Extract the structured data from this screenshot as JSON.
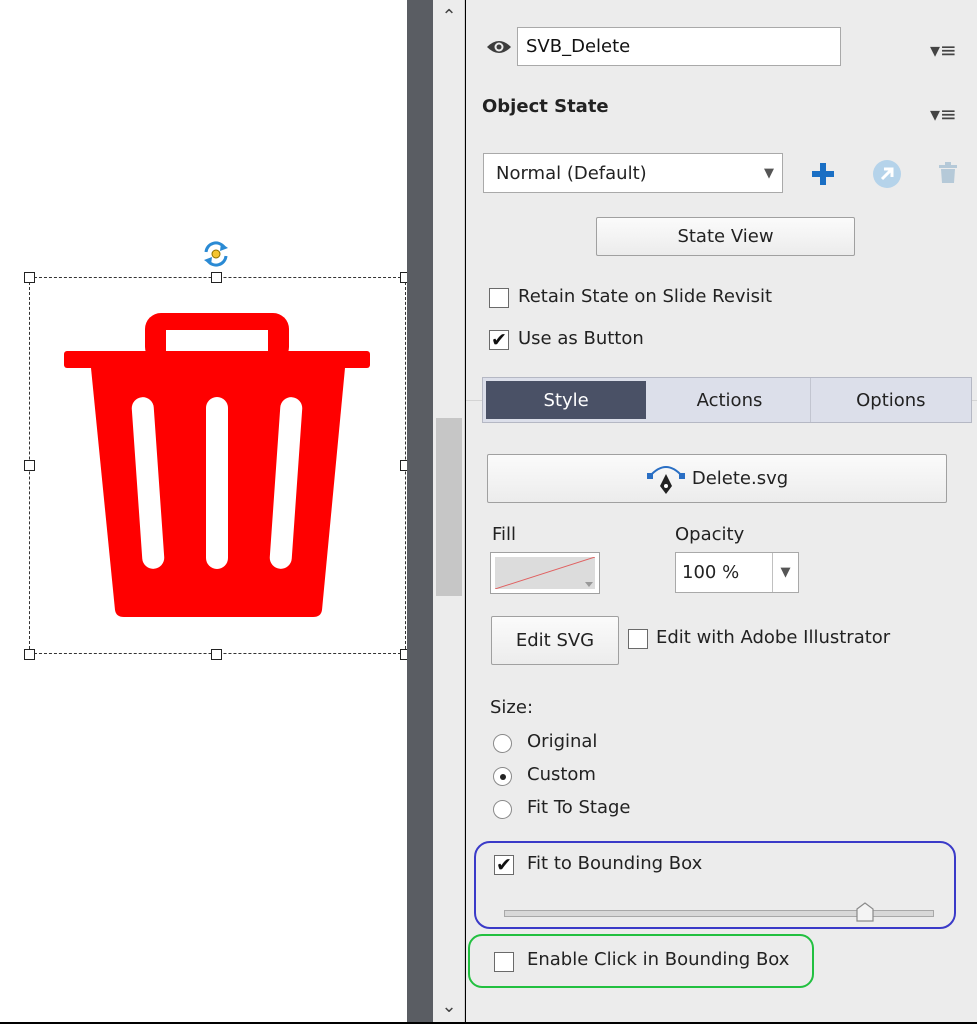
{
  "header": {
    "object_name": "SVB_Delete"
  },
  "object_state": {
    "title": "Object State",
    "selected_state": "Normal (Default)",
    "state_view_label": "State View",
    "retain_state_label": "Retain State on Slide Revisit",
    "retain_state_checked": false,
    "use_as_button_label": "Use as Button",
    "use_as_button_checked": true
  },
  "tabs": [
    {
      "label": "Style",
      "active": true
    },
    {
      "label": "Actions",
      "active": false
    },
    {
      "label": "Options",
      "active": false
    }
  ],
  "style": {
    "svg_file_label": "Delete.svg",
    "fill_label": "Fill",
    "opacity_label": "Opacity",
    "opacity_value": "100 %",
    "edit_svg_label": "Edit SVG",
    "edit_illustrator_label": "Edit with Adobe Illustrator",
    "size_label": "Size:",
    "size_options": [
      {
        "label": "Original",
        "selected": false
      },
      {
        "label": "Custom",
        "selected": true
      },
      {
        "label": "Fit To Stage",
        "selected": false
      }
    ],
    "fit_bbox_label": "Fit to Bounding Box",
    "fit_bbox_checked": true,
    "bbox_slider_value": 0.84,
    "enable_click_label": "Enable Click in Bounding Box",
    "enable_click_checked": false
  },
  "icons": {
    "visibility": "eye-icon",
    "panel_menu": "panel-menu-icon",
    "add_state": "plus-icon",
    "reset_state": "reset-icon",
    "delete_state": "trash-icon",
    "svg_file": "pen-tool-icon",
    "rotate": "rotate-handle-icon",
    "object": "trash-can-icon"
  },
  "colors": {
    "object_fill": "#ff0000",
    "add_icon": "#1a6fc4",
    "fit_highlight": "#3a3ac8",
    "click_highlight": "#22c040",
    "active_tab": "#4a5166"
  }
}
